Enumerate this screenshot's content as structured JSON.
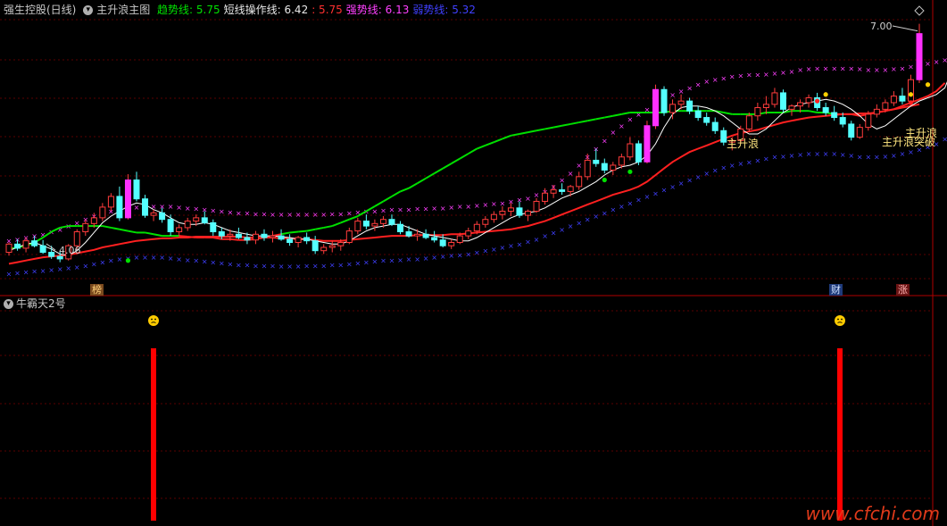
{
  "header": {
    "stock_name": "强生控股(日线)",
    "indicator_name": "主升浪主图",
    "items": [
      {
        "label": "趋势线:",
        "value": "5.75",
        "color": "#00e000"
      },
      {
        "label": "短线操作线:",
        "value": "6.42",
        "color": "#e8e8e8"
      },
      {
        "label": ":",
        "value": "5.75",
        "color": "#ff3030"
      },
      {
        "label": "强势线:",
        "value": "6.13",
        "color": "#ff40ff"
      },
      {
        "label": "弱势线:",
        "value": "5.32",
        "color": "#4040ff"
      }
    ]
  },
  "subpanel": {
    "title": "牛霸天2号"
  },
  "tags": {
    "bang": "榜",
    "cai": "财",
    "zhang": "涨"
  },
  "annotations": {
    "high_price": "7.00",
    "low_price": "4.06",
    "zhushenglang1": "主升浪",
    "zhushenglang2": "主升浪突破",
    "zhushenglang3": "主升浪"
  },
  "watermark": "www.cfchi.com",
  "colors": {
    "up": "#ff3c3c",
    "down": "#54ffff",
    "trend": "#00e000",
    "ma": "#ff2020",
    "strong": "#ff40ff",
    "weak": "#4040ff",
    "signal": "#ff0000"
  },
  "chart_data": {
    "type": "candlestick",
    "title": "主升浪主图",
    "ylabel": "",
    "price_range": [
      3.98,
      7.13
    ],
    "candles": [
      [
        4.3,
        4.42,
        4.26,
        4.4
      ],
      [
        4.4,
        4.46,
        4.32,
        4.35
      ],
      [
        4.35,
        4.48,
        4.3,
        4.44
      ],
      [
        4.44,
        4.5,
        4.36,
        4.38
      ],
      [
        4.38,
        4.45,
        4.28,
        4.3
      ],
      [
        4.3,
        4.38,
        4.22,
        4.25
      ],
      [
        4.25,
        4.32,
        4.18,
        4.22
      ],
      [
        4.22,
        4.4,
        4.2,
        4.38
      ],
      [
        4.38,
        4.58,
        4.34,
        4.55
      ],
      [
        4.55,
        4.7,
        4.5,
        4.65
      ],
      [
        4.65,
        4.78,
        4.6,
        4.72
      ],
      [
        4.72,
        4.9,
        4.68,
        4.85
      ],
      [
        4.85,
        5.02,
        4.8,
        4.98
      ],
      [
        4.98,
        5.1,
        4.68,
        4.72
      ],
      [
        4.72,
        5.25,
        4.7,
        5.18
      ],
      [
        5.18,
        5.28,
        4.92,
        4.95
      ],
      [
        4.95,
        5.0,
        4.72,
        4.75
      ],
      [
        4.75,
        4.82,
        4.68,
        4.78
      ],
      [
        4.78,
        4.84,
        4.66,
        4.7
      ],
      [
        4.7,
        4.76,
        4.5,
        4.55
      ],
      [
        4.55,
        4.64,
        4.5,
        4.6
      ],
      [
        4.6,
        4.72,
        4.56,
        4.68
      ],
      [
        4.68,
        4.76,
        4.62,
        4.72
      ],
      [
        4.72,
        4.8,
        4.64,
        4.66
      ],
      [
        4.66,
        4.7,
        4.5,
        4.55
      ],
      [
        4.55,
        4.6,
        4.46,
        4.5
      ],
      [
        4.5,
        4.58,
        4.44,
        4.52
      ],
      [
        4.52,
        4.6,
        4.46,
        4.48
      ],
      [
        4.48,
        4.54,
        4.4,
        4.45
      ],
      [
        4.45,
        4.56,
        4.4,
        4.52
      ],
      [
        4.52,
        4.58,
        4.44,
        4.48
      ],
      [
        4.48,
        4.56,
        4.42,
        4.5
      ],
      [
        4.5,
        4.58,
        4.44,
        4.46
      ],
      [
        4.46,
        4.52,
        4.38,
        4.42
      ],
      [
        4.42,
        4.5,
        4.36,
        4.48
      ],
      [
        4.48,
        4.54,
        4.4,
        4.44
      ],
      [
        4.44,
        4.5,
        4.28,
        4.32
      ],
      [
        4.32,
        4.4,
        4.28,
        4.36
      ],
      [
        4.36,
        4.44,
        4.3,
        4.38
      ],
      [
        4.38,
        4.46,
        4.32,
        4.42
      ],
      [
        4.42,
        4.6,
        4.4,
        4.56
      ],
      [
        4.56,
        4.72,
        4.52,
        4.68
      ],
      [
        4.68,
        4.76,
        4.58,
        4.62
      ],
      [
        4.62,
        4.7,
        4.56,
        4.65
      ],
      [
        4.65,
        4.74,
        4.6,
        4.7
      ],
      [
        4.7,
        4.76,
        4.62,
        4.64
      ],
      [
        4.64,
        4.68,
        4.52,
        4.55
      ],
      [
        4.55,
        4.62,
        4.48,
        4.5
      ],
      [
        4.5,
        4.58,
        4.44,
        4.52
      ],
      [
        4.52,
        4.58,
        4.46,
        4.48
      ],
      [
        4.48,
        4.56,
        4.42,
        4.45
      ],
      [
        4.45,
        4.52,
        4.36,
        4.38
      ],
      [
        4.38,
        4.46,
        4.34,
        4.42
      ],
      [
        4.42,
        4.54,
        4.4,
        4.5
      ],
      [
        4.5,
        4.6,
        4.46,
        4.56
      ],
      [
        4.56,
        4.68,
        4.52,
        4.64
      ],
      [
        4.64,
        4.74,
        4.6,
        4.7
      ],
      [
        4.7,
        4.8,
        4.66,
        4.76
      ],
      [
        4.76,
        4.86,
        4.7,
        4.8
      ],
      [
        4.8,
        4.9,
        4.74,
        4.84
      ],
      [
        4.84,
        4.92,
        4.72,
        4.75
      ],
      [
        4.75,
        4.82,
        4.68,
        4.8
      ],
      [
        4.8,
        4.96,
        4.78,
        4.92
      ],
      [
        4.92,
        5.08,
        4.88,
        5.02
      ],
      [
        5.02,
        5.12,
        4.96,
        5.06
      ],
      [
        5.06,
        5.14,
        5.0,
        5.04
      ],
      [
        5.04,
        5.12,
        4.98,
        5.1
      ],
      [
        5.1,
        5.28,
        5.06,
        5.22
      ],
      [
        5.22,
        5.5,
        5.18,
        5.42
      ],
      [
        5.42,
        5.56,
        5.34,
        5.38
      ],
      [
        5.38,
        5.44,
        5.26,
        5.3
      ],
      [
        5.3,
        5.4,
        5.24,
        5.36
      ],
      [
        5.36,
        5.5,
        5.32,
        5.46
      ],
      [
        5.46,
        5.7,
        5.42,
        5.62
      ],
      [
        5.62,
        5.66,
        5.36,
        5.4
      ],
      [
        5.4,
        5.9,
        5.38,
        5.84
      ],
      [
        5.84,
        6.34,
        5.8,
        6.28
      ],
      [
        6.28,
        6.32,
        5.96,
        6.0
      ],
      [
        6.0,
        6.16,
        5.92,
        6.1
      ],
      [
        6.1,
        6.22,
        6.04,
        6.14
      ],
      [
        6.14,
        6.18,
        5.98,
        6.02
      ],
      [
        6.02,
        6.08,
        5.9,
        5.94
      ],
      [
        5.94,
        6.0,
        5.84,
        5.88
      ],
      [
        5.88,
        5.94,
        5.74,
        5.78
      ],
      [
        5.78,
        5.82,
        5.6,
        5.64
      ],
      [
        5.64,
        5.7,
        5.54,
        5.66
      ],
      [
        5.66,
        5.84,
        5.62,
        5.8
      ],
      [
        5.8,
        6.0,
        5.76,
        5.96
      ],
      [
        5.96,
        6.12,
        5.9,
        6.06
      ],
      [
        6.06,
        6.2,
        5.98,
        6.1
      ],
      [
        6.1,
        6.3,
        6.06,
        6.24
      ],
      [
        6.24,
        6.28,
        6.0,
        6.04
      ],
      [
        6.04,
        6.1,
        5.96,
        6.08
      ],
      [
        6.08,
        6.16,
        6.0,
        6.12
      ],
      [
        6.12,
        6.22,
        6.06,
        6.18
      ],
      [
        6.18,
        6.24,
        6.02,
        6.06
      ],
      [
        6.06,
        6.12,
        5.96,
        6.0
      ],
      [
        6.0,
        6.08,
        5.9,
        5.94
      ],
      [
        5.94,
        6.0,
        5.82,
        5.86
      ],
      [
        5.86,
        5.9,
        5.66,
        5.7
      ],
      [
        5.7,
        5.86,
        5.68,
        5.82
      ],
      [
        5.82,
        6.02,
        5.78,
        5.98
      ],
      [
        5.98,
        6.1,
        5.94,
        6.04
      ],
      [
        6.04,
        6.16,
        6.0,
        6.12
      ],
      [
        6.12,
        6.26,
        6.08,
        6.2
      ],
      [
        6.2,
        6.3,
        6.1,
        6.14
      ],
      [
        6.14,
        6.46,
        6.1,
        6.4
      ],
      [
        6.4,
        7.08,
        6.36,
        6.96
      ]
    ],
    "lines": {
      "trend": [
        4.34,
        4.36,
        4.38,
        4.42,
        4.48,
        4.55,
        4.6,
        4.62,
        4.62,
        4.62,
        4.62,
        4.62,
        4.6,
        4.58,
        4.56,
        4.54,
        4.54,
        4.52,
        4.5,
        4.5,
        4.5,
        4.49,
        4.48,
        4.48,
        4.48,
        4.46,
        4.46,
        4.45,
        4.45,
        4.46,
        4.48,
        4.5,
        4.52,
        4.54,
        4.55,
        4.56,
        4.58,
        4.6,
        4.62,
        4.66,
        4.7,
        4.74,
        4.8,
        4.86,
        4.92,
        4.98,
        5.04,
        5.08,
        5.14,
        5.2,
        5.26,
        5.32,
        5.38,
        5.44,
        5.5,
        5.56,
        5.6,
        5.64,
        5.68,
        5.72,
        5.74,
        5.76,
        5.78,
        5.8,
        5.82,
        5.84,
        5.86,
        5.88,
        5.9,
        5.92,
        5.94,
        5.96,
        5.98,
        6.0,
        6.0,
        6.0,
        6.0,
        6.0,
        6.02,
        6.02,
        6.02,
        6.02,
        6.02,
        6.02,
        6.0,
        5.98,
        5.98,
        5.98,
        5.98,
        6.0,
        6.0,
        6.0,
        6.02,
        6.02,
        6.02,
        6.0,
        6.0,
        5.98,
        5.98,
        5.98,
        5.96,
        5.98,
        6.0,
        6.02,
        6.04,
        6.06,
        6.08,
        6.1,
        6.12
      ],
      "short": [
        4.32,
        4.36,
        4.4,
        4.42,
        4.38,
        4.34,
        4.28,
        4.26,
        4.32,
        4.42,
        4.54,
        4.66,
        4.74,
        4.8,
        4.86,
        4.9,
        4.88,
        4.82,
        4.78,
        4.72,
        4.66,
        4.64,
        4.64,
        4.66,
        4.64,
        4.6,
        4.56,
        4.54,
        4.52,
        4.5,
        4.5,
        4.5,
        4.49,
        4.48,
        4.46,
        4.46,
        4.44,
        4.42,
        4.4,
        4.4,
        4.44,
        4.5,
        4.56,
        4.6,
        4.62,
        4.64,
        4.64,
        4.6,
        4.56,
        4.52,
        4.5,
        4.48,
        4.46,
        4.44,
        4.44,
        4.48,
        4.54,
        4.6,
        4.66,
        4.72,
        4.76,
        4.78,
        4.8,
        4.84,
        4.9,
        4.96,
        5.0,
        5.04,
        5.1,
        5.16,
        5.24,
        5.3,
        5.34,
        5.36,
        5.4,
        5.48,
        5.62,
        5.82,
        5.98,
        6.06,
        6.08,
        6.08,
        6.06,
        6.02,
        5.96,
        5.88,
        5.8,
        5.74,
        5.74,
        5.8,
        5.9,
        6.0,
        6.06,
        6.1,
        6.12,
        6.14,
        6.16,
        6.14,
        6.1,
        6.04,
        5.96,
        5.86,
        5.8,
        5.84,
        5.92,
        6.0,
        6.08,
        6.14,
        6.18,
        6.22,
        6.3,
        6.56
      ],
      "ma": [
        4.16,
        4.18,
        4.2,
        4.22,
        4.24,
        4.25,
        4.26,
        4.27,
        4.29,
        4.31,
        4.33,
        4.36,
        4.38,
        4.4,
        4.42,
        4.44,
        4.45,
        4.46,
        4.47,
        4.47,
        4.48,
        4.48,
        4.49,
        4.49,
        4.49,
        4.49,
        4.49,
        4.49,
        4.48,
        4.48,
        4.48,
        4.48,
        4.47,
        4.47,
        4.46,
        4.46,
        4.45,
        4.44,
        4.44,
        4.44,
        4.45,
        4.46,
        4.47,
        4.48,
        4.49,
        4.5,
        4.5,
        4.5,
        4.51,
        4.51,
        4.51,
        4.51,
        4.52,
        4.52,
        4.53,
        4.54,
        4.55,
        4.56,
        4.57,
        4.58,
        4.6,
        4.62,
        4.65,
        4.68,
        4.72,
        4.76,
        4.8,
        4.84,
        4.88,
        4.92,
        4.96,
        5.0,
        5.03,
        5.06,
        5.1,
        5.16,
        5.24,
        5.32,
        5.4,
        5.46,
        5.52,
        5.56,
        5.6,
        5.64,
        5.68,
        5.72,
        5.75,
        5.77,
        5.79,
        5.82,
        5.85,
        5.88,
        5.9,
        5.92,
        5.94,
        5.95,
        5.96,
        5.97,
        5.98,
        5.98,
        5.99,
        5.99,
        6.0,
        6.02,
        6.04,
        6.08,
        6.12,
        6.16,
        6.2,
        6.26,
        6.36
      ],
      "strong": [
        4.44,
        4.46,
        4.48,
        4.5,
        4.52,
        4.55,
        4.58,
        4.62,
        4.66,
        4.7,
        4.74,
        4.78,
        4.8,
        4.82,
        4.84,
        4.85,
        4.86,
        4.86,
        4.86,
        4.86,
        4.85,
        4.84,
        4.83,
        4.82,
        4.81,
        4.8,
        4.79,
        4.78,
        4.78,
        4.77,
        4.77,
        4.76,
        4.76,
        4.76,
        4.76,
        4.76,
        4.76,
        4.76,
        4.77,
        4.77,
        4.78,
        4.79,
        4.8,
        4.8,
        4.81,
        4.82,
        4.82,
        4.82,
        4.83,
        4.83,
        4.84,
        4.84,
        4.85,
        4.86,
        4.86,
        4.87,
        4.88,
        4.89,
        4.9,
        4.92,
        4.94,
        4.96,
        5.0,
        5.04,
        5.1,
        5.18,
        5.26,
        5.36,
        5.46,
        5.56,
        5.66,
        5.76,
        5.84,
        5.92,
        5.98,
        6.04,
        6.1,
        6.16,
        6.22,
        6.26,
        6.3,
        6.34,
        6.38,
        6.4,
        6.42,
        6.44,
        6.45,
        6.46,
        6.46,
        6.47,
        6.48,
        6.49,
        6.5,
        6.52,
        6.53,
        6.54,
        6.54,
        6.54,
        6.54,
        6.54,
        6.53,
        6.52,
        6.52,
        6.52,
        6.53,
        6.54,
        6.56,
        6.58,
        6.6,
        6.62,
        6.64
      ],
      "weak": [
        4.04,
        4.05,
        4.06,
        4.07,
        4.08,
        4.09,
        4.1,
        4.11,
        4.12,
        4.14,
        4.16,
        4.18,
        4.2,
        4.22,
        4.23,
        4.24,
        4.24,
        4.24,
        4.24,
        4.23,
        4.22,
        4.21,
        4.2,
        4.19,
        4.18,
        4.17,
        4.16,
        4.15,
        4.15,
        4.14,
        4.14,
        4.14,
        4.13,
        4.13,
        4.13,
        4.14,
        4.14,
        4.14,
        4.15,
        4.15,
        4.16,
        4.17,
        4.18,
        4.19,
        4.2,
        4.2,
        4.21,
        4.22,
        4.22,
        4.23,
        4.24,
        4.25,
        4.26,
        4.27,
        4.28,
        4.3,
        4.32,
        4.34,
        4.36,
        4.38,
        4.4,
        4.43,
        4.46,
        4.5,
        4.54,
        4.58,
        4.62,
        4.66,
        4.7,
        4.74,
        4.78,
        4.82,
        4.86,
        4.9,
        4.94,
        4.98,
        5.02,
        5.06,
        5.1,
        5.14,
        5.18,
        5.22,
        5.26,
        5.3,
        5.33,
        5.36,
        5.38,
        5.4,
        5.42,
        5.44,
        5.46,
        5.47,
        5.48,
        5.49,
        5.5,
        5.5,
        5.5,
        5.5,
        5.49,
        5.48,
        5.46,
        5.46,
        5.46,
        5.47,
        5.48,
        5.5,
        5.52,
        5.55,
        5.58,
        5.62,
        5.68
      ]
    },
    "dots": [
      {
        "i": 14,
        "value": 4.2,
        "color": "#00e000"
      },
      {
        "i": 70,
        "value": 5.18,
        "color": "#00e000"
      },
      {
        "i": 73,
        "value": 5.28,
        "color": "#00e000"
      },
      {
        "i": 95,
        "value": 6.14,
        "color": "#ff2020"
      },
      {
        "i": 96,
        "value": 6.22,
        "color": "#ffd000"
      },
      {
        "i": 106,
        "value": 6.22,
        "color": "#ffd000"
      },
      {
        "i": 106,
        "value": 6.12,
        "color": "#ff2020"
      },
      {
        "i": 108,
        "value": 6.34,
        "color": "#ffd000"
      }
    ],
    "sub_signals": [
      {
        "i": 21,
        "value": 1
      },
      {
        "i": 121,
        "value": 1
      }
    ],
    "sub_range": [
      0,
      1
    ]
  }
}
